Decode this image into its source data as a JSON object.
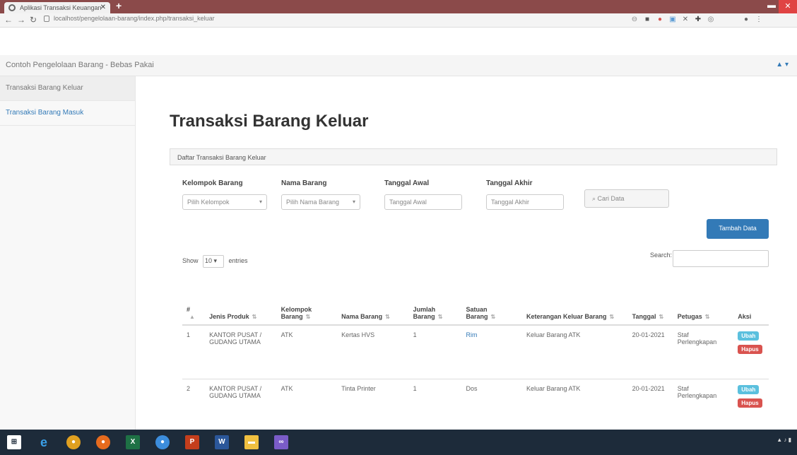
{
  "browser": {
    "tab_title": "Aplikasi Transaksi Keuangan",
    "url": "localhost/pengelolaan-barang/index.php/transaksi_keluar"
  },
  "app": {
    "brand": "Contoh Pengelolaan Barang - Bebas Pakai",
    "user_menu": "▲ ▾"
  },
  "sidebar": {
    "items": [
      {
        "label": "Transaksi Barang Keluar"
      },
      {
        "label": "Transaksi Barang Masuk"
      }
    ]
  },
  "main": {
    "title": "Transaksi Barang Keluar",
    "panel_heading": "Daftar Transaksi Barang Keluar",
    "filters": {
      "kelompok_label": "Kelompok Barang",
      "kelompok_value": "Pilih Kelompok",
      "nama_label": "Nama Barang",
      "nama_value": "Pilih Nama Barang",
      "tgl_awal_label": "Tanggal Awal",
      "tgl_awal_placeholder": "Tanggal Awal",
      "tgl_akhir_label": "Tanggal Akhir",
      "tgl_akhir_placeholder": "Tanggal Akhir",
      "search_button": "Cari Data"
    },
    "add_button": "Tambah Data",
    "datatable": {
      "show_label": "Show",
      "length_value": "10",
      "entries_label": "entries",
      "search_label": "Search:"
    },
    "columns": [
      "#",
      "Jenis Produk",
      "Kelompok Barang",
      "Nama Barang",
      "Jumlah Barang",
      "Satuan Barang",
      "Keterangan Keluar Barang",
      "Tanggal",
      "Petugas",
      "Aksi"
    ],
    "rows": [
      {
        "no": "1",
        "jenis": "KANTOR PUSAT / GUDANG UTAMA",
        "kelompok": "ATK",
        "nama": "Kertas HVS",
        "jumlah": "1",
        "satuan": "Rim",
        "keterangan": "Keluar Barang ATK",
        "tanggal": "20-01-2021",
        "petugas": "Staf Perlengkapan",
        "edit": "Ubah",
        "delete": "Hapus"
      },
      {
        "no": "2",
        "jenis": "KANTOR PUSAT / GUDANG UTAMA",
        "kelompok": "ATK",
        "nama": "Tinta Printer",
        "jumlah": "1",
        "satuan": "Dos",
        "keterangan": "Keluar Barang ATK",
        "tanggal": "20-01-2021",
        "petugas": "Staf Perlengkapan",
        "edit": "Ubah",
        "delete": "Hapus"
      }
    ]
  },
  "colors": {
    "primary": "#337ab7",
    "info": "#5bc0de",
    "danger": "#d9534f",
    "tabbar": "#8b4a4a"
  }
}
